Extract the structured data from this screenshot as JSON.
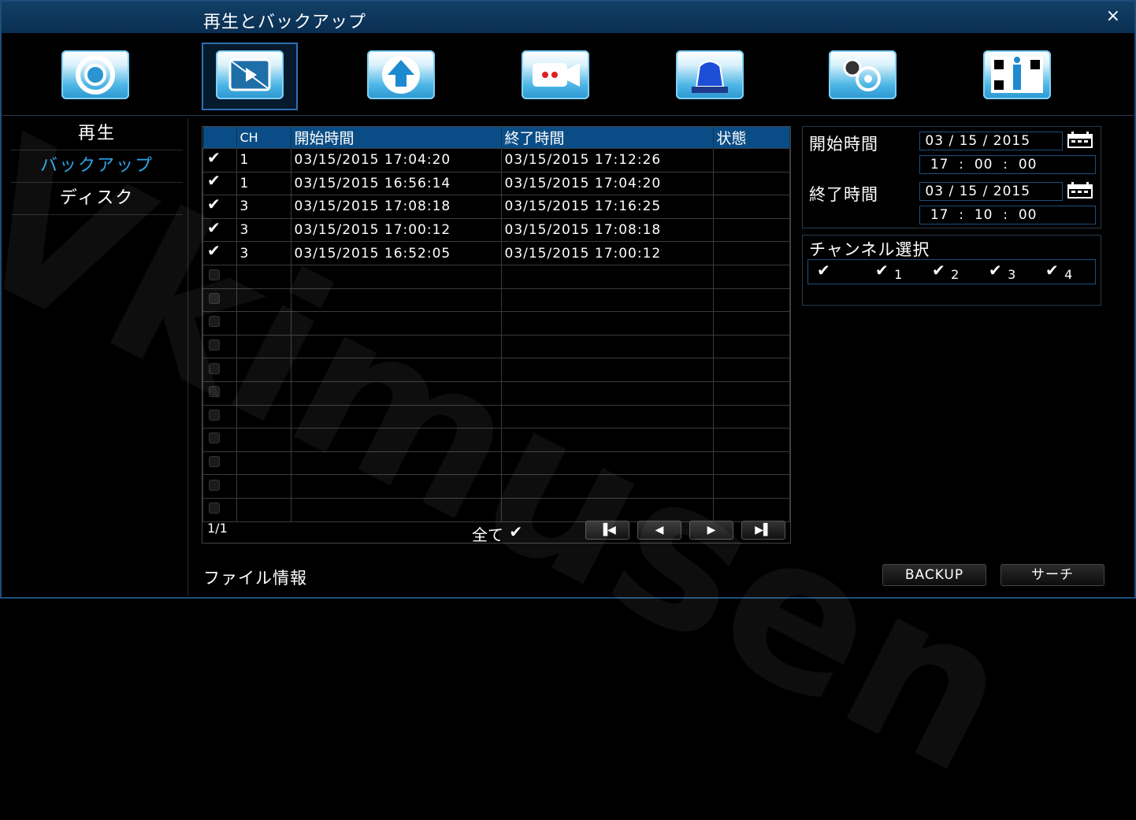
{
  "window": {
    "title": "再生とバックアップ",
    "close_label": "×"
  },
  "toolbar": {
    "icons": [
      "settings-gear-icon",
      "playback-backup-icon",
      "upgrade-arrow-icon",
      "camera-record-icon",
      "alarm-siren-icon",
      "advanced-settings-icon",
      "qr-info-icon"
    ],
    "selected_index": 1
  },
  "sidebar": {
    "items": [
      {
        "label": "再生"
      },
      {
        "label": "バックアップ"
      },
      {
        "label": "ディスク"
      }
    ],
    "active_index": 1
  },
  "table": {
    "headers": [
      "CH",
      "開始時間",
      "終了時間",
      "状態"
    ],
    "rows": [
      {
        "checked": true,
        "ch": "1",
        "start": "03/15/2015 17:04:20",
        "end": "03/15/2015 17:12:26",
        "status": ""
      },
      {
        "checked": true,
        "ch": "1",
        "start": "03/15/2015 16:56:14",
        "end": "03/15/2015 17:04:20",
        "status": ""
      },
      {
        "checked": true,
        "ch": "3",
        "start": "03/15/2015 17:08:18",
        "end": "03/15/2015 17:16:25",
        "status": ""
      },
      {
        "checked": true,
        "ch": "3",
        "start": "03/15/2015 17:00:12",
        "end": "03/15/2015 17:08:18",
        "status": ""
      },
      {
        "checked": true,
        "ch": "3",
        "start": "03/15/2015 16:52:05",
        "end": "03/15/2015 17:00:12",
        "status": ""
      }
    ],
    "empty_rows": 11,
    "page": "1/1",
    "select_all_label": "全て",
    "select_all_checked": true
  },
  "search": {
    "start_label": "開始時間",
    "start_date": {
      "month": "03",
      "day": "15",
      "year": "2015"
    },
    "start_time": {
      "hour": "17",
      "min": "00",
      "sec": "00"
    },
    "end_label": "終了時間",
    "end_date": {
      "month": "03",
      "day": "15",
      "year": "2015"
    },
    "end_time": {
      "hour": "17",
      "min": "10",
      "sec": "00"
    },
    "date_sep": "/",
    "time_sep": ":"
  },
  "channel_select": {
    "label": "チャンネル選択",
    "channels": [
      "1",
      "2",
      "3",
      "4"
    ],
    "all_checked": true
  },
  "file_info_label": "ファイル情報",
  "buttons": {
    "backup": "BACKUP",
    "search": "サーチ"
  },
  "watermark": "Vkimusen",
  "colors": {
    "accent": "#2aa4ea",
    "header": "#0a4d86",
    "titlebar": "#0f3d63"
  }
}
